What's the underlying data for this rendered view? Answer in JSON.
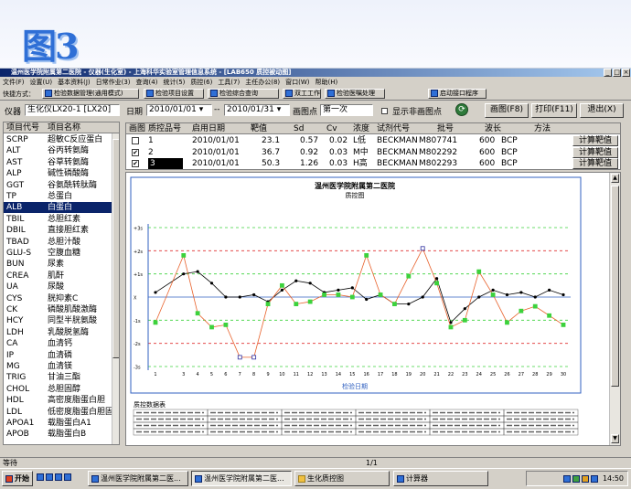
{
  "banner": {
    "word": "图3"
  },
  "window": {
    "title": "温州医学院附属第二医院 - 仪器(生化室) - 上海科华实验室管理信息系统 - [LAB650 质控被动图]"
  },
  "menu": [
    "文件(F)",
    "设置(U)",
    "基本资料(J)",
    "日常作业(3)",
    "查询(4)",
    "统计(5)",
    "质控(6)",
    "工具(7)",
    "主任办公(8)",
    "窗口(W)",
    "帮助(H)"
  ],
  "toolbar": {
    "quick_label": "快捷方式：",
    "buttons": [
      "检验数据管理(通用模式)",
      "检验项目设置",
      "检验综合查询",
      "双工工作单",
      "检验医嘱处理"
    ],
    "right_button": "启动接口程序"
  },
  "controls": {
    "instrument_label": "仪器",
    "instrument_value": "生化仪LX20-1 [LX20]",
    "date_label": "日期",
    "date_from": "2010/01/01",
    "date_sep": "--",
    "date_to": "2010/01/31",
    "plot_label": "画图点",
    "plot_value": "第一次",
    "show_non_label": "显示非画图点",
    "draw_button": "画图(F8)",
    "print_button": "打印(F11)",
    "exit_button": "退出(X)"
  },
  "items": {
    "headers": [
      "项目代号",
      "项目名称"
    ],
    "rows": [
      {
        "code": "SCRP",
        "name": "超敏C反应蛋白"
      },
      {
        "code": "ALT",
        "name": "谷丙转氨酶"
      },
      {
        "code": "AST",
        "name": "谷草转氨酶"
      },
      {
        "code": "ALP",
        "name": "碱性磷酸酶"
      },
      {
        "code": "GGT",
        "name": "谷氨酰转肽酶"
      },
      {
        "code": "TP",
        "name": "总蛋白"
      },
      {
        "code": "ALB",
        "name": "白蛋白"
      },
      {
        "code": "TBIL",
        "name": "总胆红素"
      },
      {
        "code": "DBIL",
        "name": "直接胆红素"
      },
      {
        "code": "TBAD",
        "name": "总胆汁酸"
      },
      {
        "code": "GLU-S",
        "name": "空腹血糖"
      },
      {
        "code": "BUN",
        "name": "尿素"
      },
      {
        "code": "CREA",
        "name": "肌酐"
      },
      {
        "code": "UA",
        "name": "尿酸"
      },
      {
        "code": "CYS",
        "name": "胱抑素C"
      },
      {
        "code": "CK",
        "name": "磷酸肌酸激酶"
      },
      {
        "code": "HCY",
        "name": "同型半胱氨酸"
      },
      {
        "code": "LDH",
        "name": "乳酸脱氢酶"
      },
      {
        "code": "CA",
        "name": "血清钙"
      },
      {
        "code": "IP",
        "name": "血清磷"
      },
      {
        "code": "MG",
        "name": "血清镁"
      },
      {
        "code": "TRIG",
        "name": "甘油三酯"
      },
      {
        "code": "CHOL",
        "name": "总胆固醇"
      },
      {
        "code": "HDL",
        "name": "高密度脂蛋白胆"
      },
      {
        "code": "LDL",
        "name": "低密度脂蛋白胆固"
      },
      {
        "code": "APOA1",
        "name": "载脂蛋白A1"
      },
      {
        "code": "APOB",
        "name": "载脂蛋白B"
      }
    ],
    "selected_index": 6
  },
  "qc_grid": {
    "headers": [
      "画图",
      "质控品号",
      "启用日期",
      "靶值",
      "Sd",
      "Cv",
      "浓度",
      "试剂代号",
      "批号",
      "波长",
      "方法"
    ],
    "rows": [
      {
        "draw": "",
        "no": "1",
        "date": "2010/01/01",
        "target": "23.1",
        "sd": "0.57",
        "cv": "0.02",
        "level": "L低",
        "reagent": "BECKMAN",
        "lot": "M807741",
        "wave": "600",
        "method": "BCP",
        "calc": "计算靶值"
      },
      {
        "draw": "✔",
        "no": "2",
        "date": "2010/01/01",
        "target": "36.7",
        "sd": "0.92",
        "cv": "0.03",
        "level": "M中",
        "reagent": "BECKMAN",
        "lot": "M802292",
        "wave": "600",
        "method": "BCP",
        "calc": "计算靶值"
      },
      {
        "draw": "✔",
        "no": "3",
        "date": "2010/01/01",
        "target": "50.3",
        "sd": "1.26",
        "cv": "0.03",
        "level": "H高",
        "reagent": "BECKMAN",
        "lot": "M802293",
        "wave": "600",
        "method": "BCP",
        "calc": "计算靶值"
      }
    ]
  },
  "report": {
    "hospital": "温州医学院附属第二医院",
    "title": "质控图",
    "xlabel": "检验日期",
    "table_title": "质控数据表"
  },
  "chart_data": {
    "type": "line",
    "x": [
      1,
      3,
      4,
      5,
      6,
      7,
      8,
      9,
      10,
      11,
      12,
      13,
      14,
      15,
      16,
      17,
      18,
      19,
      20,
      21,
      22,
      23,
      24,
      25,
      26,
      27,
      28,
      29,
      30
    ],
    "xticks": [
      1,
      3,
      4,
      5,
      6,
      7,
      8,
      9,
      10,
      11,
      12,
      13,
      14,
      15,
      16,
      17,
      18,
      19,
      20,
      21,
      22,
      23,
      24,
      25,
      26,
      27,
      28,
      29,
      30
    ],
    "yticks": [
      "+3s",
      "+2s",
      "+1s",
      "X",
      "-1s",
      "-2s",
      "-3s"
    ],
    "series": [
      {
        "color": "#000000",
        "values": [
          0.2,
          1.0,
          1.1,
          0.6,
          0.0,
          0.0,
          0.1,
          -0.2,
          0.3,
          0.7,
          0.6,
          0.2,
          0.3,
          0.4,
          -0.1,
          0.1,
          -0.3,
          -0.3,
          0.0,
          0.8,
          -1.1,
          -0.5,
          0.0,
          0.3,
          0.1,
          0.2,
          0.0,
          0.3,
          0.1
        ]
      },
      {
        "color": "#e8622c",
        "values": [
          -1.1,
          1.8,
          -0.7,
          -1.3,
          -1.2,
          -2.6,
          -2.6,
          -0.3,
          0.5,
          -0.3,
          -0.2,
          0.1,
          0.1,
          0.0,
          1.8,
          0.1,
          -0.3,
          0.9,
          2.1,
          0.6,
          -1.3,
          -1.0,
          1.1,
          0.1,
          -1.1,
          -0.6,
          -0.4,
          -0.8,
          -1.2
        ]
      }
    ]
  },
  "status": {
    "left": "等待",
    "page": "1/1"
  },
  "taskbar": {
    "start": "开始",
    "tasks": [
      "温州医学院附属第二医...",
      "温州医学院附属第二医...",
      "生化质控图",
      "计算器"
    ],
    "time": "14:50"
  },
  "colors": {
    "titlebar": "#0a246a",
    "selected": "#0a246a",
    "series_a": "#000000",
    "series_b": "#e8622c",
    "green_points": "#3cd23c"
  }
}
